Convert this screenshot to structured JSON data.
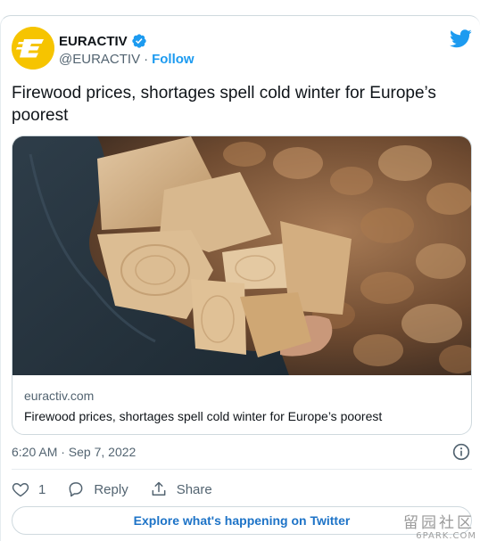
{
  "author": {
    "name": "EURACTIV",
    "handle": "@EURACTIV",
    "separator": "·",
    "follow_label": "Follow",
    "avatar_icon": "euractiv-logo-icon",
    "brand_color": "#f6c400"
  },
  "tweet": {
    "text": "Firewood prices, shortages spell cold winter for Europe’s poorest"
  },
  "link_card": {
    "domain": "euractiv.com",
    "title": "Firewood prices, shortages spell cold winter for Europe’s poorest"
  },
  "meta": {
    "timestamp": "6:20 AM · Sep 7, 2022"
  },
  "actions": {
    "like_count": "1",
    "reply_label": "Reply",
    "share_label": "Share"
  },
  "explore": {
    "label": "Explore what's happening on Twitter"
  },
  "watermark": {
    "chars": "留园社区",
    "site": "6PARK.COM"
  },
  "colors": {
    "accent": "#1d9bf0",
    "secondary_text": "#536471",
    "border": "#cfd9de"
  }
}
